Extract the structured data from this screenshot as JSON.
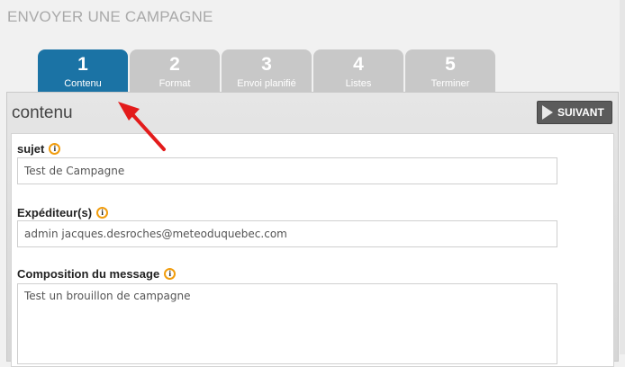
{
  "page": {
    "title": "ENVOYER UNE CAMPAGNE"
  },
  "steps": [
    {
      "num": "1",
      "label": "Contenu",
      "active": true
    },
    {
      "num": "2",
      "label": "Format",
      "active": false
    },
    {
      "num": "3",
      "label": "Envoi planifié",
      "active": false
    },
    {
      "num": "4",
      "label": "Listes",
      "active": false
    },
    {
      "num": "5",
      "label": "Terminer",
      "active": false
    }
  ],
  "panel": {
    "title": "contenu",
    "next_label": "SUIVANT"
  },
  "form": {
    "subject": {
      "label": "sujet",
      "value": "Test de Campagne"
    },
    "sender": {
      "label": "Expéditeur(s)",
      "value": "admin jacques.desroches@meteoduquebec.com"
    },
    "message": {
      "label": "Composition du message",
      "value": "Test un brouillon de campagne"
    }
  },
  "icons": {
    "info": "info-icon",
    "next": "play-arrow-icon",
    "annotation": "red-arrow-icon"
  },
  "colors": {
    "active_tab": "#1b73a5",
    "inactive_tab": "#c8c8c8",
    "info_ring": "#f19d0e",
    "annotation_arrow": "#e31b1b"
  }
}
